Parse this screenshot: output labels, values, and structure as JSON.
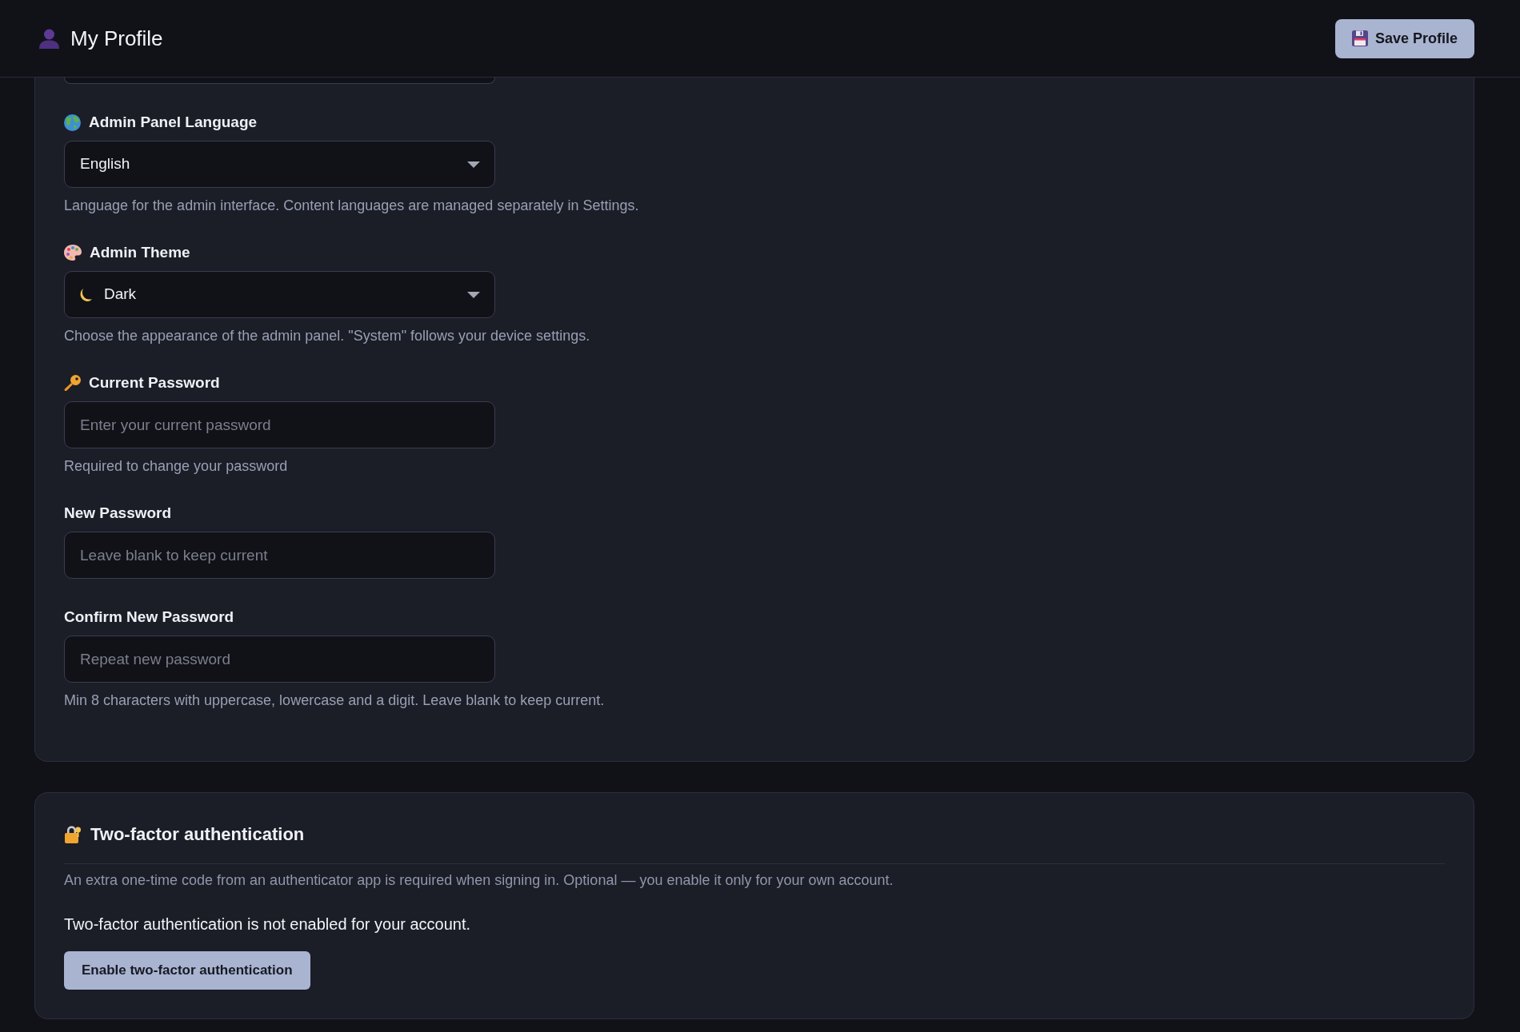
{
  "header": {
    "title": "My Profile",
    "save_button": "Save Profile"
  },
  "profile_form": {
    "fields": [
      {
        "kind": "clipped"
      },
      {
        "kind": "select",
        "label": "Admin Panel Language",
        "value": "English",
        "help": "Language for the admin interface. Content languages are managed separately in Settings."
      },
      {
        "kind": "select",
        "label": "Admin Theme",
        "value": "Dark",
        "help": "Choose the appearance of the admin panel. \"System\" follows your device settings."
      },
      {
        "kind": "password",
        "label": "Current Password",
        "placeholder": "Enter your current password",
        "help": "Required to change your password"
      },
      {
        "kind": "password",
        "label": "New Password",
        "placeholder": "Leave blank to keep current"
      },
      {
        "kind": "password",
        "label": "Confirm New Password",
        "placeholder": "Repeat new password",
        "help": "Min 8 characters with uppercase, lowercase and a digit. Leave blank to keep current."
      }
    ]
  },
  "two_factor": {
    "title": "Two-factor authentication",
    "description": "An extra one-time code from an authenticator app is required when signing in. Optional — you enable it only for your own account.",
    "status": "Two-factor authentication is not enabled for your account.",
    "button": "Enable two-factor authentication"
  }
}
